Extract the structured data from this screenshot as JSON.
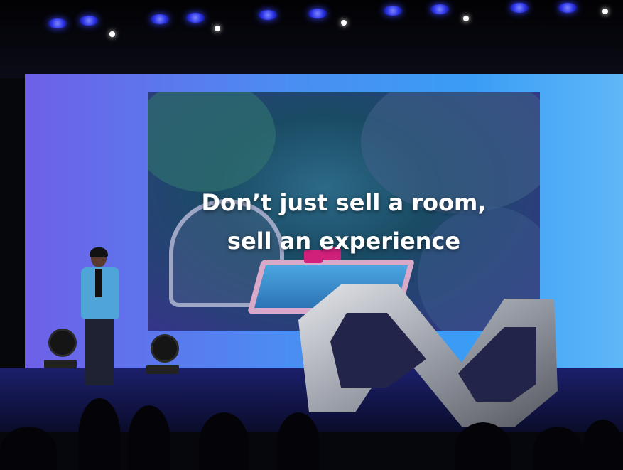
{
  "slide": {
    "caption_line1": "Don’t just sell a room,",
    "caption_line2": "sell an experience"
  },
  "colors": {
    "screen_left": "#6e60e8",
    "screen_right": "#5fb7f7",
    "ceiling_light": "#2b33e6",
    "jacket": "#4fa4d8",
    "logo_metal": "#b9bcc4"
  },
  "icons": {
    "stage_logo": "infinity-logo-icon",
    "fixtures": "stage-light-icon"
  }
}
